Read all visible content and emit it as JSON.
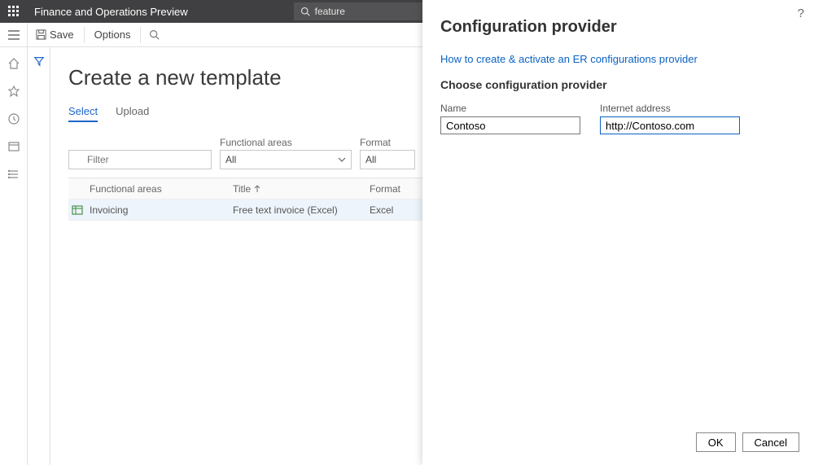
{
  "topbar": {
    "app_title": "Finance and Operations Preview",
    "search_text": "feature"
  },
  "cmdbar": {
    "save": "Save",
    "options": "Options"
  },
  "page": {
    "title": "Create a new template",
    "tabs": {
      "select": "Select",
      "upload": "Upload"
    },
    "filter": {
      "placeholder": "Filter",
      "fa_label": "Functional areas",
      "fa_value": "All",
      "format_label": "Format",
      "format_value": "All"
    },
    "grid": {
      "cols": {
        "fa": "Functional areas",
        "title": "Title",
        "format": "Format"
      },
      "rows": [
        {
          "fa": "Invoicing",
          "title": "Free text invoice (Excel)",
          "format": "Excel"
        }
      ]
    }
  },
  "rightpane": {
    "title": "Configuration provider",
    "link": "How to create & activate an ER configurations provider",
    "subtitle": "Choose configuration provider",
    "name_label": "Name",
    "name_value": "Contoso",
    "addr_label": "Internet address",
    "addr_value": "http://Contoso.com",
    "ok": "OK",
    "cancel": "Cancel",
    "help": "?"
  }
}
